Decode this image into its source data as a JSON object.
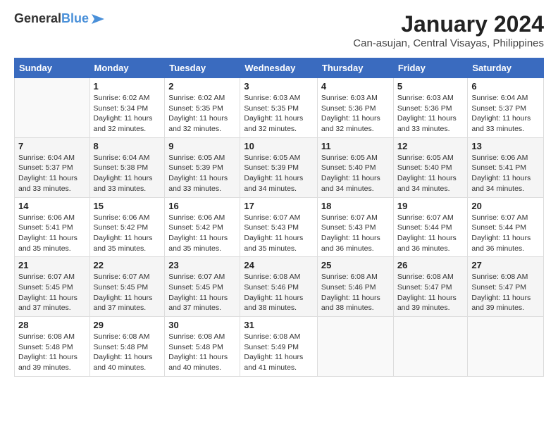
{
  "header": {
    "logo": {
      "general": "General",
      "blue": "Blue"
    },
    "month": "January 2024",
    "location": "Can-asujan, Central Visayas, Philippines"
  },
  "weekdays": [
    "Sunday",
    "Monday",
    "Tuesday",
    "Wednesday",
    "Thursday",
    "Friday",
    "Saturday"
  ],
  "weeks": [
    [
      {
        "day": "",
        "sunrise": "",
        "sunset": "",
        "daylight": ""
      },
      {
        "day": "1",
        "sunrise": "6:02 AM",
        "sunset": "5:34 PM",
        "daylight": "11 hours and 32 minutes."
      },
      {
        "day": "2",
        "sunrise": "6:02 AM",
        "sunset": "5:35 PM",
        "daylight": "11 hours and 32 minutes."
      },
      {
        "day": "3",
        "sunrise": "6:03 AM",
        "sunset": "5:35 PM",
        "daylight": "11 hours and 32 minutes."
      },
      {
        "day": "4",
        "sunrise": "6:03 AM",
        "sunset": "5:36 PM",
        "daylight": "11 hours and 32 minutes."
      },
      {
        "day": "5",
        "sunrise": "6:03 AM",
        "sunset": "5:36 PM",
        "daylight": "11 hours and 33 minutes."
      },
      {
        "day": "6",
        "sunrise": "6:04 AM",
        "sunset": "5:37 PM",
        "daylight": "11 hours and 33 minutes."
      }
    ],
    [
      {
        "day": "7",
        "sunrise": "6:04 AM",
        "sunset": "5:37 PM",
        "daylight": "11 hours and 33 minutes."
      },
      {
        "day": "8",
        "sunrise": "6:04 AM",
        "sunset": "5:38 PM",
        "daylight": "11 hours and 33 minutes."
      },
      {
        "day": "9",
        "sunrise": "6:05 AM",
        "sunset": "5:39 PM",
        "daylight": "11 hours and 33 minutes."
      },
      {
        "day": "10",
        "sunrise": "6:05 AM",
        "sunset": "5:39 PM",
        "daylight": "11 hours and 34 minutes."
      },
      {
        "day": "11",
        "sunrise": "6:05 AM",
        "sunset": "5:40 PM",
        "daylight": "11 hours and 34 minutes."
      },
      {
        "day": "12",
        "sunrise": "6:05 AM",
        "sunset": "5:40 PM",
        "daylight": "11 hours and 34 minutes."
      },
      {
        "day": "13",
        "sunrise": "6:06 AM",
        "sunset": "5:41 PM",
        "daylight": "11 hours and 34 minutes."
      }
    ],
    [
      {
        "day": "14",
        "sunrise": "6:06 AM",
        "sunset": "5:41 PM",
        "daylight": "11 hours and 35 minutes."
      },
      {
        "day": "15",
        "sunrise": "6:06 AM",
        "sunset": "5:42 PM",
        "daylight": "11 hours and 35 minutes."
      },
      {
        "day": "16",
        "sunrise": "6:06 AM",
        "sunset": "5:42 PM",
        "daylight": "11 hours and 35 minutes."
      },
      {
        "day": "17",
        "sunrise": "6:07 AM",
        "sunset": "5:43 PM",
        "daylight": "11 hours and 35 minutes."
      },
      {
        "day": "18",
        "sunrise": "6:07 AM",
        "sunset": "5:43 PM",
        "daylight": "11 hours and 36 minutes."
      },
      {
        "day": "19",
        "sunrise": "6:07 AM",
        "sunset": "5:44 PM",
        "daylight": "11 hours and 36 minutes."
      },
      {
        "day": "20",
        "sunrise": "6:07 AM",
        "sunset": "5:44 PM",
        "daylight": "11 hours and 36 minutes."
      }
    ],
    [
      {
        "day": "21",
        "sunrise": "6:07 AM",
        "sunset": "5:45 PM",
        "daylight": "11 hours and 37 minutes."
      },
      {
        "day": "22",
        "sunrise": "6:07 AM",
        "sunset": "5:45 PM",
        "daylight": "11 hours and 37 minutes."
      },
      {
        "day": "23",
        "sunrise": "6:07 AM",
        "sunset": "5:45 PM",
        "daylight": "11 hours and 37 minutes."
      },
      {
        "day": "24",
        "sunrise": "6:08 AM",
        "sunset": "5:46 PM",
        "daylight": "11 hours and 38 minutes."
      },
      {
        "day": "25",
        "sunrise": "6:08 AM",
        "sunset": "5:46 PM",
        "daylight": "11 hours and 38 minutes."
      },
      {
        "day": "26",
        "sunrise": "6:08 AM",
        "sunset": "5:47 PM",
        "daylight": "11 hours and 39 minutes."
      },
      {
        "day": "27",
        "sunrise": "6:08 AM",
        "sunset": "5:47 PM",
        "daylight": "11 hours and 39 minutes."
      }
    ],
    [
      {
        "day": "28",
        "sunrise": "6:08 AM",
        "sunset": "5:48 PM",
        "daylight": "11 hours and 39 minutes."
      },
      {
        "day": "29",
        "sunrise": "6:08 AM",
        "sunset": "5:48 PM",
        "daylight": "11 hours and 40 minutes."
      },
      {
        "day": "30",
        "sunrise": "6:08 AM",
        "sunset": "5:48 PM",
        "daylight": "11 hours and 40 minutes."
      },
      {
        "day": "31",
        "sunrise": "6:08 AM",
        "sunset": "5:49 PM",
        "daylight": "11 hours and 41 minutes."
      },
      {
        "day": "",
        "sunrise": "",
        "sunset": "",
        "daylight": ""
      },
      {
        "day": "",
        "sunrise": "",
        "sunset": "",
        "daylight": ""
      },
      {
        "day": "",
        "sunrise": "",
        "sunset": "",
        "daylight": ""
      }
    ]
  ]
}
